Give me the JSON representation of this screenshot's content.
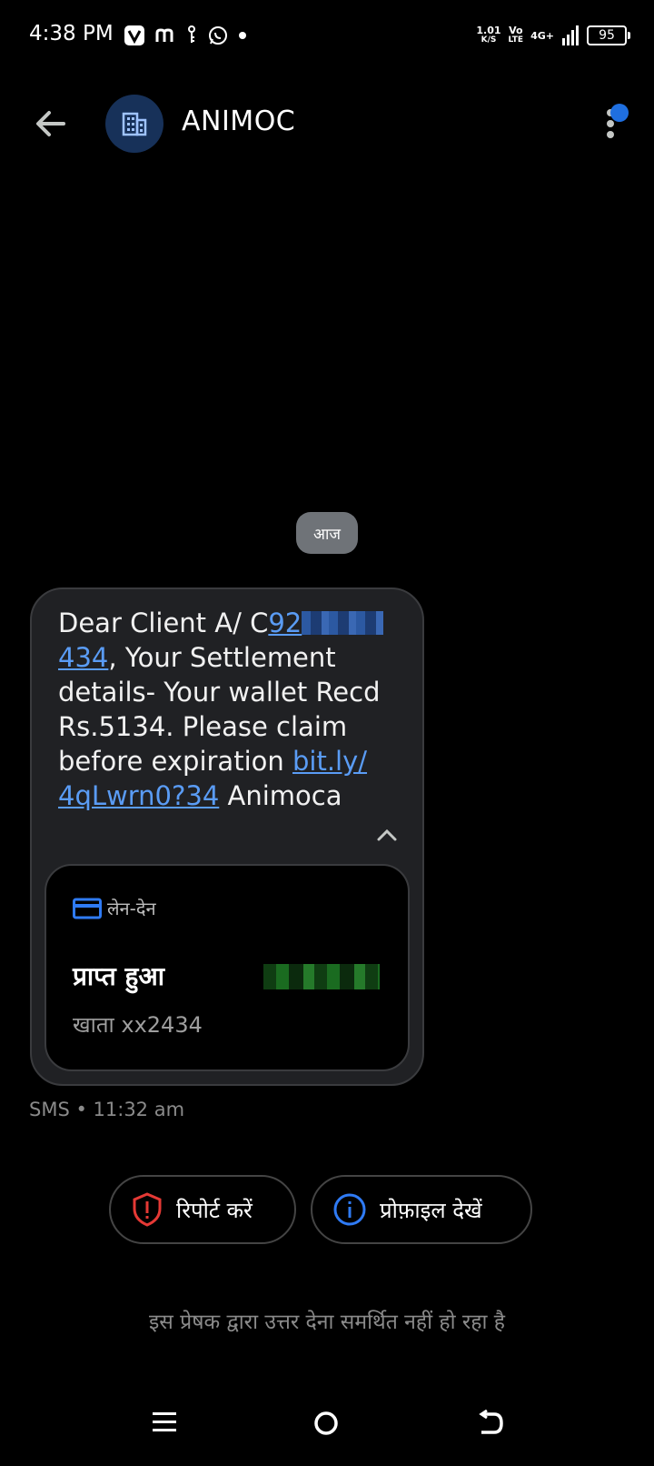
{
  "status_bar": {
    "time": "4:38 PM",
    "net_speed_value": "1.01",
    "net_speed_unit": "K/S",
    "volte_top": "Vo",
    "volte_bottom": "LTE",
    "network": "4G+",
    "battery": "95"
  },
  "header": {
    "contact_name": "ANIMOC",
    "avatar_icon": "business-building-icon"
  },
  "date_chip": "आज",
  "message": {
    "text_pre": "Dear Client A/ C",
    "account_link_start": "92",
    "account_link_end": "434",
    "text_mid": ", Your Settlement details- Your wallet Recd Rs.5134. Please claim before expiration ",
    "url": "bit.ly/ 4qLwrn0?34",
    "text_post": " Animoca",
    "card": {
      "category": "लेन-देन",
      "status": "प्राप्त हुआ",
      "account": "खाता xx2434"
    },
    "meta": "SMS • 11:32 am"
  },
  "actions": {
    "report_label": "रिपोर्ट करें",
    "profile_label": "प्रोफ़ाइल देखें"
  },
  "footer_note": "इस प्रेषक द्वारा उत्तर देना समर्थित नहीं हो रहा है",
  "colors": {
    "accent_blue": "#1f6fe0",
    "link_blue": "#5a9cf5",
    "report_red": "#e53935",
    "bubble_bg": "#202124"
  }
}
